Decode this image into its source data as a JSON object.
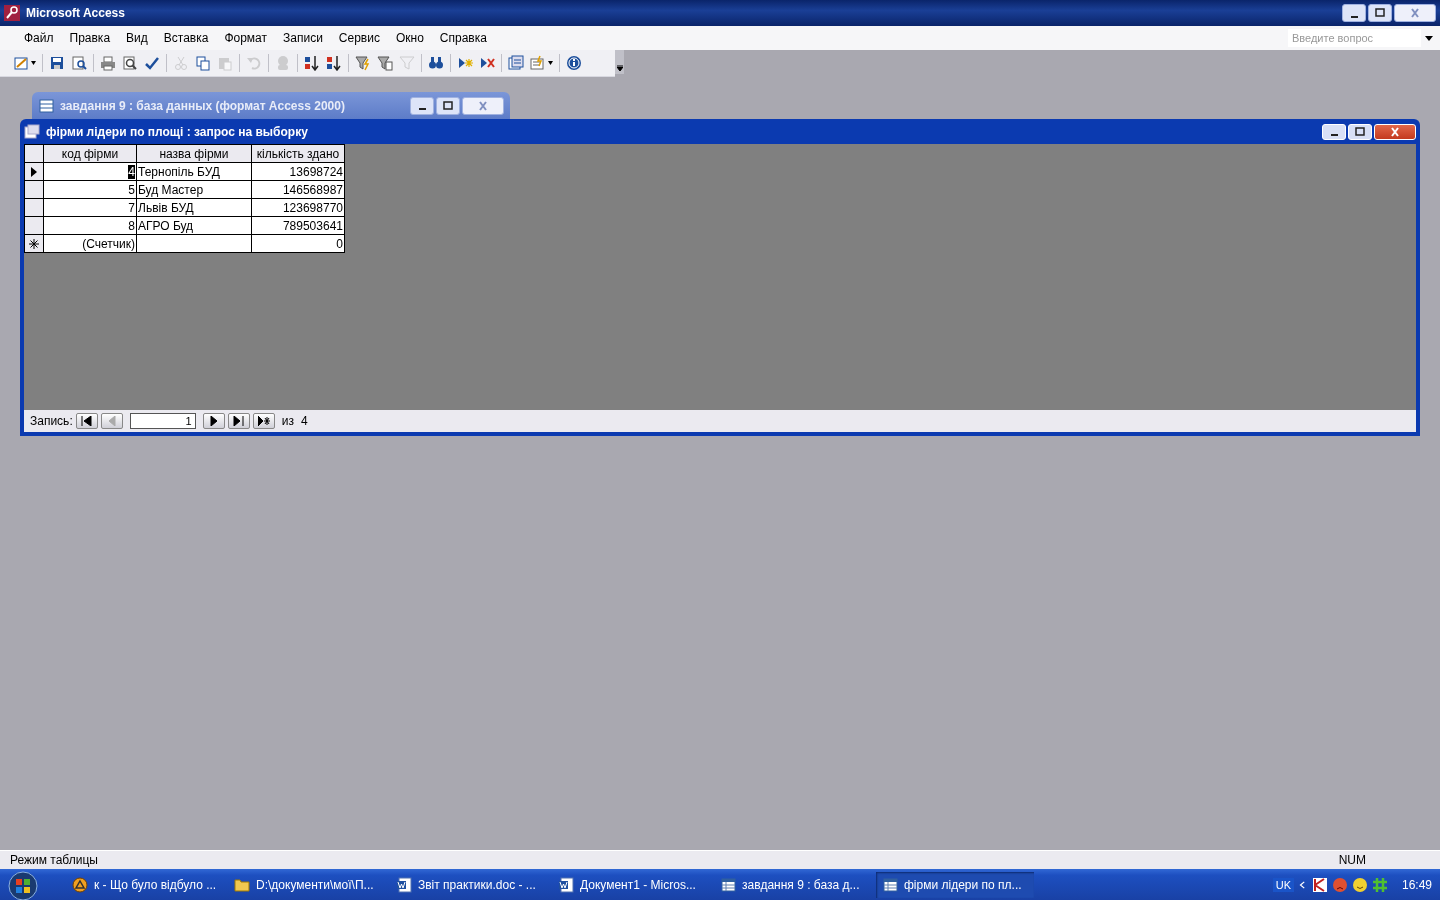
{
  "window": {
    "title": "Microsoft Access"
  },
  "menu": [
    "Файл",
    "Правка",
    "Вид",
    "Вставка",
    "Формат",
    "Записи",
    "Сервис",
    "Окно",
    "Справка"
  ],
  "question_box": {
    "placeholder": "Введите вопрос"
  },
  "toolbar": [
    {
      "kind": "view",
      "disabled": false
    },
    {
      "kind": "separator"
    },
    {
      "kind": "save",
      "disabled": false
    },
    {
      "kind": "search",
      "disabled": false
    },
    {
      "kind": "separator"
    },
    {
      "kind": "print",
      "disabled": false
    },
    {
      "kind": "preview",
      "disabled": false
    },
    {
      "kind": "spell",
      "disabled": false
    },
    {
      "kind": "separator"
    },
    {
      "kind": "cut",
      "disabled": true
    },
    {
      "kind": "copy",
      "disabled": false
    },
    {
      "kind": "paste",
      "disabled": true
    },
    {
      "kind": "separator"
    },
    {
      "kind": "undo",
      "disabled": true
    },
    {
      "kind": "separator"
    },
    {
      "kind": "link",
      "disabled": true
    },
    {
      "kind": "separator"
    },
    {
      "kind": "sort-asc",
      "disabled": false
    },
    {
      "kind": "sort-desc",
      "disabled": false
    },
    {
      "kind": "separator"
    },
    {
      "kind": "filter-selection",
      "disabled": false
    },
    {
      "kind": "filter-form",
      "disabled": false
    },
    {
      "kind": "filter",
      "disabled": true
    },
    {
      "kind": "separator"
    },
    {
      "kind": "find",
      "disabled": false
    },
    {
      "kind": "separator"
    },
    {
      "kind": "new-record",
      "disabled": false
    },
    {
      "kind": "delete-record",
      "disabled": false
    },
    {
      "kind": "separator"
    },
    {
      "kind": "db-window",
      "disabled": false
    },
    {
      "kind": "new-object",
      "disabled": false
    },
    {
      "kind": "separator"
    },
    {
      "kind": "help",
      "disabled": false
    }
  ],
  "db_window": {
    "title": "завдання 9 : база данных (формат Access 2000)"
  },
  "query_window": {
    "title": "фірми лідери по площі : запрос на выборку",
    "table": {
      "columns": [
        "код фірми",
        "назва фірми",
        "кількість здано"
      ],
      "rows": [
        {
          "kind": "record",
          "current": true,
          "cells": [
            "4",
            "Тернопіль БУД",
            "13698724"
          ]
        },
        {
          "kind": "record",
          "current": false,
          "cells": [
            "5",
            "Буд Мастер",
            "146568987"
          ]
        },
        {
          "kind": "record",
          "current": false,
          "cells": [
            "7",
            "Львів БУД",
            "123698770"
          ]
        },
        {
          "kind": "record",
          "current": false,
          "cells": [
            "8",
            "АГРО Буд",
            "789503641"
          ]
        },
        {
          "kind": "new",
          "current": false,
          "cells": [
            "(Счетчик)",
            "",
            "0"
          ]
        }
      ]
    },
    "navigation": {
      "label": "Запись:",
      "value": "1",
      "of_label": "из",
      "total": "4"
    }
  },
  "status_bar": {
    "mode": "Режим таблицы",
    "num": "NUM"
  },
  "taskbar": {
    "items": [
      {
        "kind": "browser",
        "label": "к - Що було відбуло ...",
        "selected": false
      },
      {
        "kind": "folder",
        "label": "D:\\документи\\мої\\П...",
        "selected": false
      },
      {
        "kind": "word",
        "label": "Звіт практики.doc - ...",
        "selected": false
      },
      {
        "kind": "word",
        "label": "Документ1 - Micros...",
        "selected": false
      },
      {
        "kind": "access",
        "label": "завдання 9 : база д...",
        "selected": false
      },
      {
        "kind": "access",
        "label": "фірми лідери по пл...",
        "selected": true
      }
    ],
    "language": "UK",
    "clock": "16:49"
  }
}
